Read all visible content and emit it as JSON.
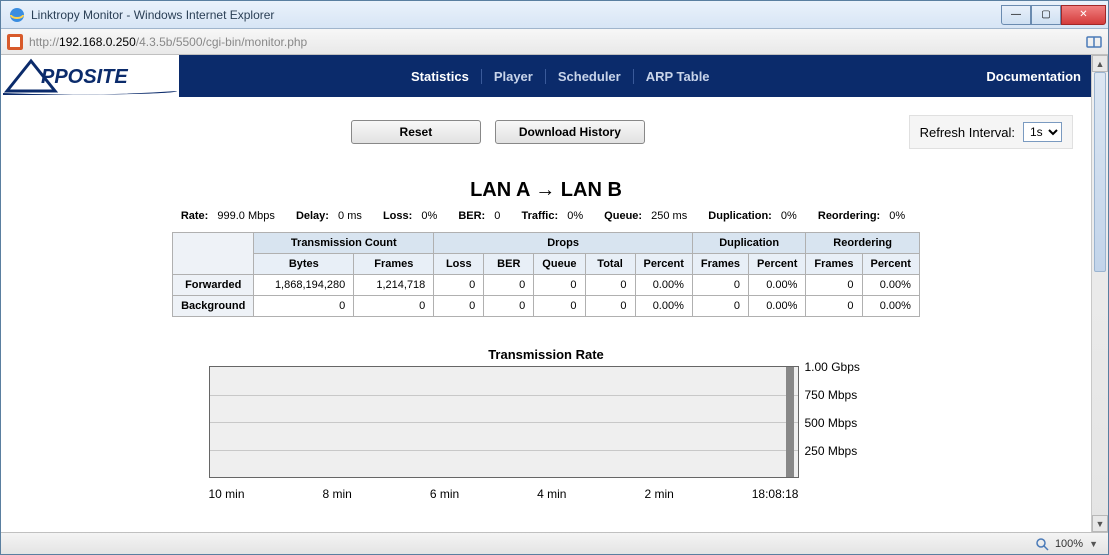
{
  "window": {
    "title": "Linktropy Monitor - Windows Internet Explorer",
    "url_prefix": "http://",
    "url_host": "192.168.0.250",
    "url_path": "/4.3.5b/5500/cgi-bin/monitor.php"
  },
  "nav": {
    "items": [
      "Statistics",
      "Player",
      "Scheduler",
      "ARP Table"
    ],
    "active": "Statistics",
    "doc": "Documentation"
  },
  "buttons": {
    "reset": "Reset",
    "download": "Download History"
  },
  "refresh": {
    "label": "Refresh Interval:",
    "value": "1s",
    "options": [
      "1s"
    ]
  },
  "heading": "LAN A → LAN B",
  "params": {
    "rate_label": "Rate:",
    "rate": "999.0 Mbps",
    "delay_label": "Delay:",
    "delay": "0 ms",
    "loss_label": "Loss:",
    "loss": "0%",
    "ber_label": "BER:",
    "ber": "0",
    "traffic_label": "Traffic:",
    "traffic": "0%",
    "queue_label": "Queue:",
    "queue": "250 ms",
    "dup_label": "Duplication:",
    "dup": "0%",
    "reorder_label": "Reordering:",
    "reorder": "0%"
  },
  "table": {
    "group_headers": [
      "Transmission Count",
      "Drops",
      "Duplication",
      "Reordering"
    ],
    "sub_headers": [
      "Bytes",
      "Frames",
      "Loss",
      "BER",
      "Queue",
      "Total",
      "Percent",
      "Frames",
      "Percent",
      "Frames",
      "Percent"
    ],
    "rows": [
      {
        "label": "Forwarded",
        "cells": [
          "1,868,194,280",
          "1,214,718",
          "0",
          "0",
          "0",
          "0",
          "0.00%",
          "0",
          "0.00%",
          "0",
          "0.00%"
        ]
      },
      {
        "label": "Background",
        "cells": [
          "0",
          "0",
          "0",
          "0",
          "0",
          "0",
          "0.00%",
          "0",
          "0.00%",
          "0",
          "0.00%"
        ]
      }
    ]
  },
  "chart_data": {
    "type": "bar",
    "title": "Transmission Rate",
    "ylabels": [
      "1.00 Gbps",
      "750 Mbps",
      "500 Mbps",
      "250 Mbps"
    ],
    "ylim_mbps": [
      0,
      1000
    ],
    "xlabels": [
      "10 min",
      "8 min",
      "6 min",
      "4 min",
      "2 min",
      "18:08:18"
    ],
    "current_value_mbps": 999,
    "series": [
      {
        "name": "Transmission Rate",
        "x": "18:08:18",
        "value_mbps": 999
      }
    ]
  },
  "statusbar": {
    "zoom": "100%"
  }
}
